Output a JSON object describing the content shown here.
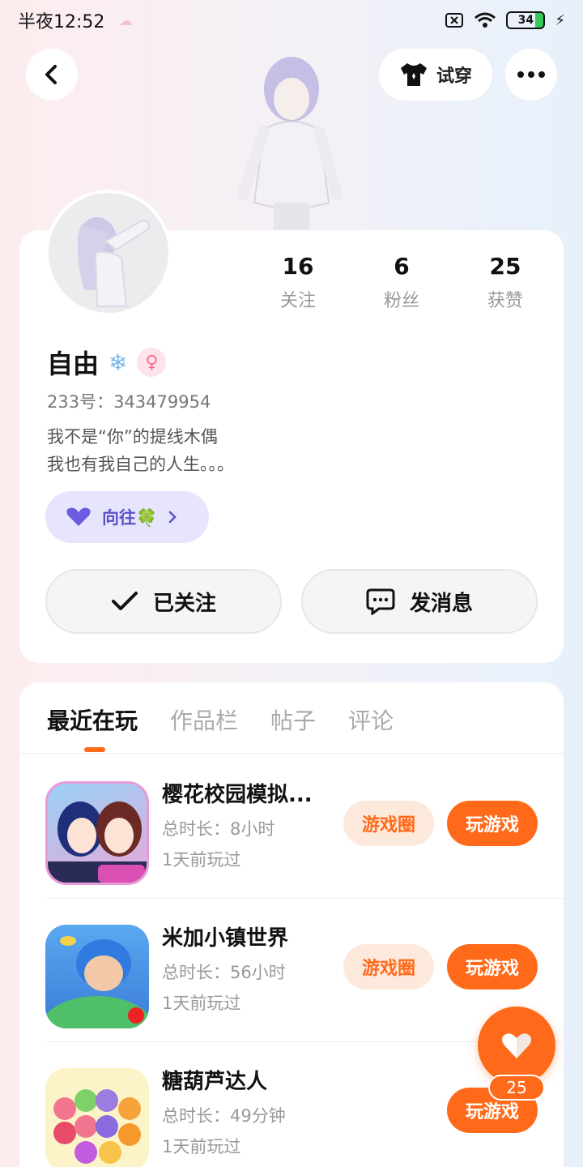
{
  "status_bar": {
    "time": "半夜12:52",
    "battery": "34"
  },
  "header": {
    "try_on_label": "试穿"
  },
  "profile": {
    "stats": [
      {
        "value": "16",
        "label": "关注"
      },
      {
        "value": "6",
        "label": "粉丝"
      },
      {
        "value": "25",
        "label": "获赞"
      }
    ],
    "name": "自由",
    "uid": "233号：343479954",
    "bio_line1": "我不是“你”的提线木偶",
    "bio_line2": "我也有我自己的人生。。。",
    "tag_label": "向往🍀",
    "follow_label": "已关注",
    "message_label": "发消息"
  },
  "tabs": [
    "最近在玩",
    "作品栏",
    "帖子",
    "评论"
  ],
  "games": [
    {
      "title": "樱花校园模拟...",
      "duration": "总时长：8小时",
      "last_played": "1天前玩过",
      "circle_label": "游戏圈",
      "play_label": "玩游戏"
    },
    {
      "title": "米加小镇世界",
      "duration": "总时长：56小时",
      "last_played": "1天前玩过",
      "circle_label": "游戏圈",
      "play_label": "玩游戏"
    },
    {
      "title": "糖葫芦达人",
      "duration": "总时长：49分钟",
      "last_played": "1天前玩过",
      "play_label": "玩游戏"
    }
  ],
  "like": {
    "count": "25"
  },
  "colors": {
    "accent": "#ff6a1a",
    "tag_bg": "#e7e4fd",
    "tag_text": "#5a52c8"
  }
}
